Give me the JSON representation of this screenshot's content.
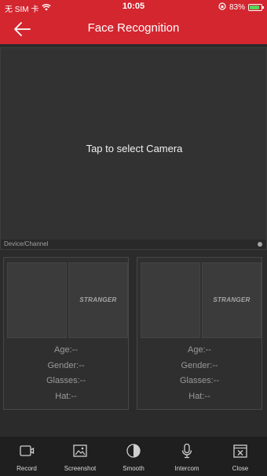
{
  "status_bar": {
    "carrier": "无 SIM 卡",
    "time": "10:05",
    "battery_percent": "83%",
    "battery_level": 0.83
  },
  "header": {
    "title": "Face Recognition",
    "back_icon": "back-arrow-icon"
  },
  "video": {
    "placeholder": "Tap to select Camera",
    "device_label": "Device/Channel"
  },
  "cards": [
    {
      "stranger_label": "STRANGER",
      "age": "Age:--",
      "gender": "Gender:--",
      "glasses": "Glasses:--",
      "hat": "Hat:--"
    },
    {
      "stranger_label": "STRANGER",
      "age": "Age:--",
      "gender": "Gender:--",
      "glasses": "Glasses:--",
      "hat": "Hat:--"
    }
  ],
  "toolbar": {
    "items": [
      {
        "label": "Record",
        "icon": "record-icon"
      },
      {
        "label": "Screenshot",
        "icon": "screenshot-icon"
      },
      {
        "label": "Smooth",
        "icon": "smooth-icon"
      },
      {
        "label": "Intercom",
        "icon": "microphone-icon"
      },
      {
        "label": "Close",
        "icon": "close-icon"
      }
    ]
  },
  "colors": {
    "header": "#d3262f",
    "background": "#2b2b2b",
    "toolbar": "#1f1f1f"
  }
}
